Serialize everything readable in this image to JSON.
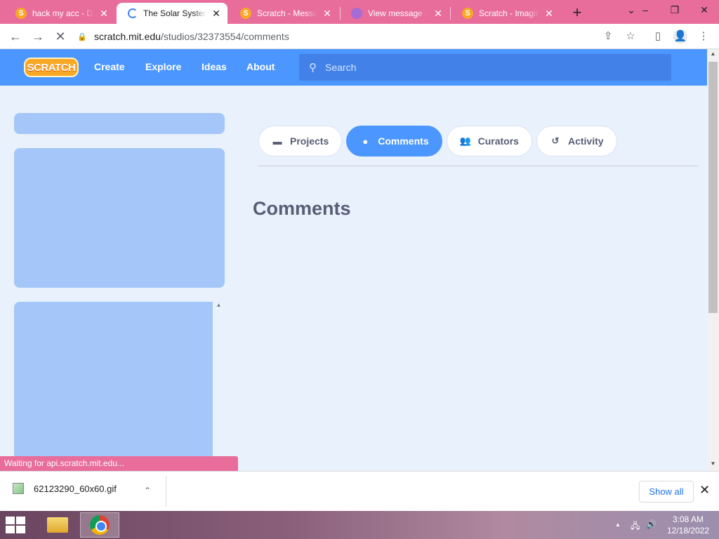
{
  "browser": {
    "tabs": [
      {
        "title": "hack my acc - Dis",
        "favicon": "scratch-cat-icon"
      },
      {
        "title": "The Solar System",
        "favicon": "loading-spinner-icon"
      },
      {
        "title": "Scratch - Messag",
        "favicon": "scratch-cat-icon"
      },
      {
        "title": "View message - I",
        "favicon": "purple-circle-icon"
      },
      {
        "title": "Scratch - Imagine",
        "favicon": "scratch-cat-icon"
      }
    ],
    "active_tab_index": 1,
    "url_host": "scratch.mit.edu",
    "url_path": "/studios/32373554/comments",
    "status_text": "Waiting for api.scratch.mit.edu..."
  },
  "scratch": {
    "logo_text": "SCRATCH",
    "nav": {
      "create": "Create",
      "explore": "Explore",
      "ideas": "Ideas",
      "about": "About"
    },
    "search_placeholder": "Search",
    "studio_tabs": [
      {
        "label": "Projects",
        "icon": "projects-icon",
        "active": false
      },
      {
        "label": "Comments",
        "icon": "comment-bubble-icon",
        "active": true
      },
      {
        "label": "Curators",
        "icon": "curators-icon",
        "active": false
      },
      {
        "label": "Activity",
        "icon": "history-icon",
        "active": false
      }
    ],
    "section_heading": "Comments"
  },
  "downloads": {
    "file_name": "62123290_60x60.gif",
    "show_all": "Show all"
  },
  "taskbar": {
    "time": "3:08 AM",
    "date": "12/18/2022"
  },
  "colors": {
    "scratch_blue": "#4c97ff",
    "tab_strip_pink": "#e86d9a",
    "placeholder_blue": "#a4c6f9",
    "page_bg": "#e9f1fc"
  }
}
